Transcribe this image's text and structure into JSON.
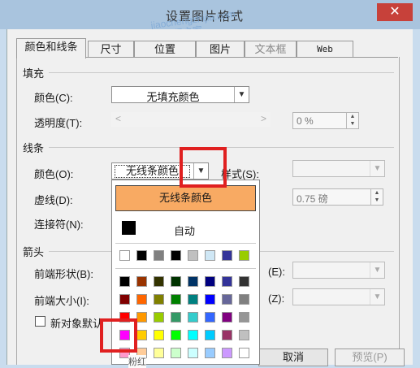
{
  "window": {
    "title": "设置图片格式",
    "close_glyph": "✕",
    "watermark_line1": "jiaochengzhijia.com",
    "watermark_line2": "教程之家"
  },
  "tabs": [
    {
      "label": "颜色和线条",
      "active": true,
      "disabled": false
    },
    {
      "label": "尺寸",
      "active": false,
      "disabled": false
    },
    {
      "label": "位置",
      "active": false,
      "disabled": false
    },
    {
      "label": "图片",
      "active": false,
      "disabled": false
    },
    {
      "label": "文本框",
      "active": false,
      "disabled": true
    },
    {
      "label": "Web",
      "active": false,
      "disabled": false
    }
  ],
  "fill": {
    "section_label": "填充",
    "color_label": "颜色(C):",
    "color_value": "无填充颜色",
    "transparency_label": "透明度(T):",
    "transparency_value": "0 %"
  },
  "line": {
    "section_label": "线条",
    "color_label": "颜色(O):",
    "color_value": "无线条颜色",
    "style_label": "样式(S):",
    "dash_label": "虚线(D):",
    "weight_value": "0.75 磅",
    "connector_label": "连接符(N):"
  },
  "arrows": {
    "section_label": "箭头",
    "begin_style_label": "前端形状(B):",
    "begin_size_label": "前端大小(I):",
    "end_style_label": "(E):",
    "end_size_label": "(Z):"
  },
  "default_checkbox_label": "新对象默认",
  "color_popup": {
    "no_line_label": "无线条颜色",
    "auto_label": "自动",
    "hover_tooltip": "粉红",
    "recent_colors": [
      "#ffffff",
      "#000000",
      "#808080",
      "#000000",
      "#c0c0c0",
      "#cfe7f5",
      "#333399",
      "#008080",
      "#99cc00"
    ],
    "palette": [
      [
        "#000000",
        "#993300",
        "#333300",
        "#003300",
        "#003366",
        "#000080",
        "#333399",
        "#333333"
      ],
      [
        "#800000",
        "#ff6600",
        "#808000",
        "#008000",
        "#008080",
        "#0000ff",
        "#666699",
        "#808080"
      ],
      [
        "#ff0000",
        "#ff9900",
        "#99cc00",
        "#339966",
        "#33cccc",
        "#3366ff",
        "#800080",
        "#969696"
      ],
      [
        "#ff00ff",
        "#ffcc00",
        "#ffff00",
        "#00ff00",
        "#00ffff",
        "#00ccff",
        "#993366",
        "#c0c0c0"
      ],
      [
        "#ff99cc",
        "#ffcc99",
        "#ffff99",
        "#ccffcc",
        "#ccffff",
        "#99ccff",
        "#cc99ff",
        "#ffffff"
      ]
    ],
    "highlight_color": "#e02020"
  },
  "buttons": {
    "cancel_label": "取消",
    "preview_label": "预览(P)"
  }
}
